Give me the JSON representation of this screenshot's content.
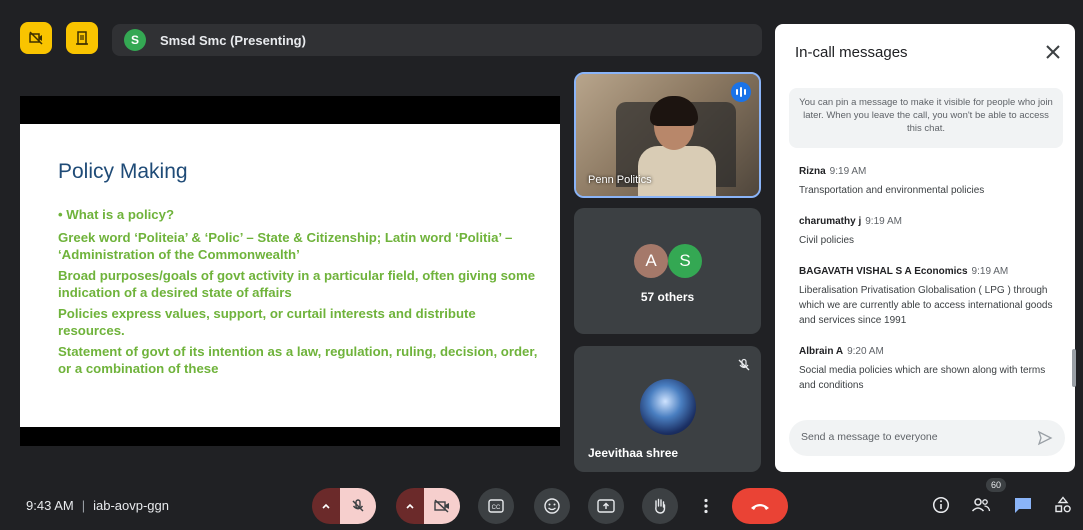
{
  "topbar": {
    "presenter_initial": "S",
    "presenter_label": "Smsd Smc (Presenting)"
  },
  "slide": {
    "title": "Policy Making",
    "bullets": [
      "• What is a policy?",
      "Greek word ‘Politeia’ & ‘Polic’ – State & Citizenship; Latin word ‘Politia’ – ‘Administration of the Commonwealth’",
      "Broad purposes/goals of govt activity in a particular field, often giving some indication of a desired state of affairs",
      "Policies express values, support, or curtail interests and distribute resources.",
      "Statement of govt of its intention as a law, regulation, ruling, decision, order, or a combination of these"
    ]
  },
  "tiles": {
    "speaker_label": "Penn Politics",
    "group_avatar_1": "A",
    "group_avatar_2": "S",
    "group_avatar_1_color": "#a5796a",
    "group_avatar_2_color": "#34a853",
    "others_label": "57 others",
    "participant_name": "Jeevithaa shree"
  },
  "chat": {
    "title": "In-call messages",
    "pin_note": "You can pin a message to make it visible for people who join later. When you leave the call, you won't be able to access this chat.",
    "messages": [
      {
        "sender": "Rizna",
        "time": "9:19 AM",
        "text": "Transportation and environmental policies"
      },
      {
        "sender": "charumathy j",
        "time": "9:19 AM",
        "text": "Civil policies"
      },
      {
        "sender": "BAGAVATH VISHAL S A Economics",
        "time": "9:19 AM",
        "text": "Liberalisation Privatisation Globalisation ( LPG ) through which we are currently able to access international goods and services since 1991"
      },
      {
        "sender": "Albrain A",
        "time": "9:20 AM",
        "text": "Social media policies which are shown along with terms and conditions"
      }
    ],
    "input_placeholder": "Send a message to everyone"
  },
  "bottombar": {
    "time": "9:43 AM",
    "meeting_code": "iab-aovp-ggn",
    "participants_count": "60"
  },
  "colors": {
    "accent_yellow": "#f9c400",
    "end_call_red": "#ea4335",
    "slide_title_blue": "#1f4b77",
    "slide_body_green": "#6fb33b",
    "active_blue": "#8ab4f8"
  },
  "icons": [
    "no-camera-icon",
    "hand-raise-icon",
    "mic-off-icon",
    "camera-off-icon",
    "captions-icon",
    "emoji-icon",
    "present-icon",
    "raise-hand-icon",
    "more-icon",
    "end-call-icon",
    "info-icon",
    "people-icon",
    "chat-icon",
    "activities-icon",
    "close-icon",
    "send-icon"
  ]
}
